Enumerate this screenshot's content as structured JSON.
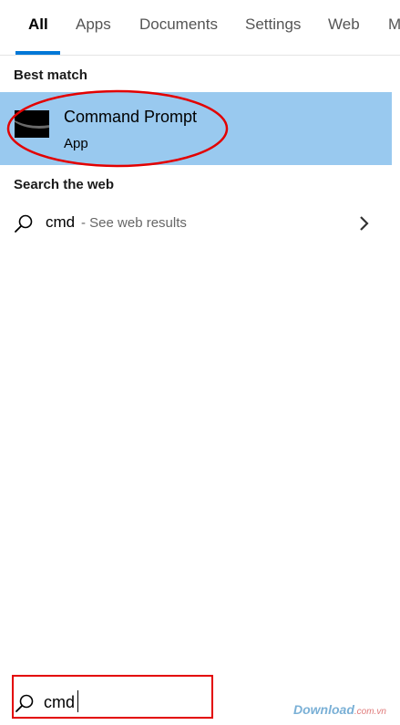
{
  "tabs": [
    {
      "label": "All",
      "active": true
    },
    {
      "label": "Apps",
      "active": false
    },
    {
      "label": "Documents",
      "active": false
    },
    {
      "label": "Settings",
      "active": false
    },
    {
      "label": "Web",
      "active": false
    },
    {
      "label": "M",
      "active": false
    }
  ],
  "best_match": {
    "heading": "Best match",
    "app_name": "Command Prompt",
    "app_type": "App",
    "icon": "command-prompt-icon"
  },
  "web": {
    "heading": "Search the web",
    "query": "cmd",
    "suffix": " - See web results",
    "icon": "search-icon",
    "arrow_icon": "chevron-right-icon"
  },
  "search_box": {
    "value": "cmd",
    "icon": "search-icon"
  },
  "watermark": {
    "brand": "Download",
    "domain": ".com.vn"
  },
  "colors": {
    "accent": "#0078d7",
    "selection": "#99c9ef",
    "annotation": "#e30000"
  }
}
